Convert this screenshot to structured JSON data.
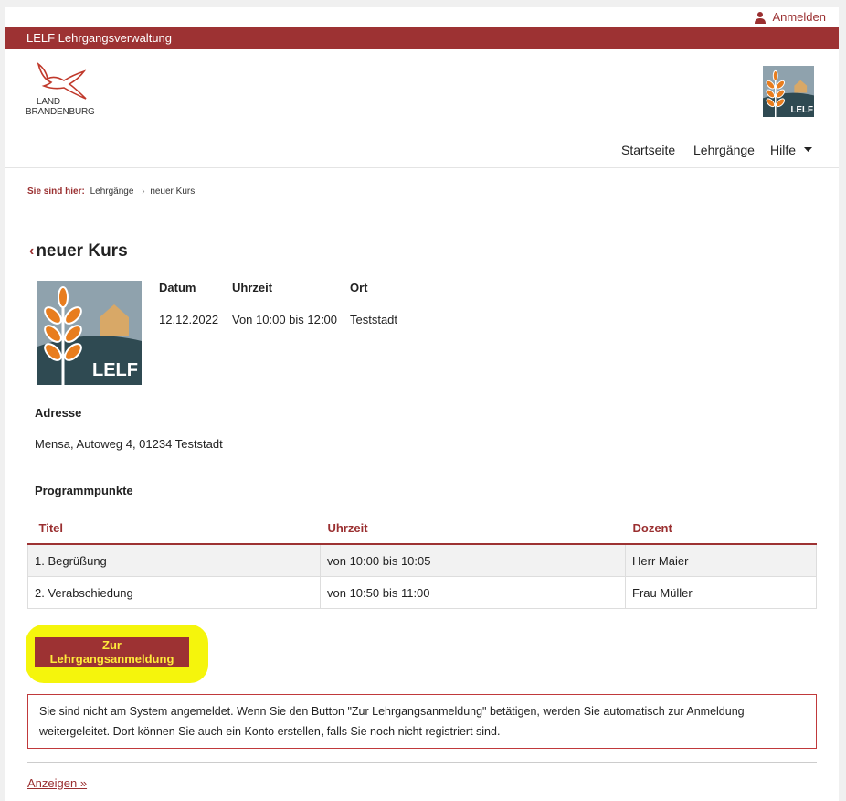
{
  "header": {
    "login_label": "Anmelden",
    "app_title": "LELF Lehrgangsverwaltung",
    "brand_logo_text_line1": "LAND",
    "brand_logo_text_line2": "BRANDENBURG",
    "lelf_logo_text": "LELF"
  },
  "nav": {
    "items": [
      {
        "label": "Startseite"
      },
      {
        "label": "Lehrgänge"
      },
      {
        "label": "Hilfe"
      }
    ]
  },
  "breadcrumb": {
    "prefix": "Sie sind hier:",
    "items": [
      "Lehrgänge",
      "neuer Kurs"
    ]
  },
  "course": {
    "title": "neuer Kurs",
    "image_text": "LELF",
    "date_label": "Datum",
    "date_value": "12.12.2022",
    "time_label": "Uhrzeit",
    "time_value": "Von 10:00 bis 12:00",
    "place_label": "Ort",
    "place_value": "Teststadt",
    "address_label": "Adresse",
    "address_value": "Mensa, Autoweg 4, 01234 Teststadt",
    "program_label": "Programmpunkte"
  },
  "program": {
    "headers": [
      "Titel",
      "Uhrzeit",
      "Dozent"
    ],
    "rows": [
      [
        "1. Begrüßung",
        "von 10:00 bis 10:05",
        "Herr Maier"
      ],
      [
        "2. Verabschiedung",
        "von 10:50 bis 11:00",
        "Frau Müller"
      ]
    ]
  },
  "actions": {
    "register_button": "Zur Lehrgangsanmeldung",
    "notice": "Sie sind nicht am System angemeldet. Wenn Sie den Button \"Zur Lehrgangsanmeldung\" betätigen, werden Sie automatisch zur Anmeldung weitergeleitet. Dort können Sie auch ein Konto erstellen, falls Sie noch nicht registriert sind.",
    "show_more": "Anzeigen »"
  },
  "colors": {
    "brand_red": "#9d3233",
    "button_text": "#ffeb3b",
    "highlight": "#f5f50c"
  }
}
